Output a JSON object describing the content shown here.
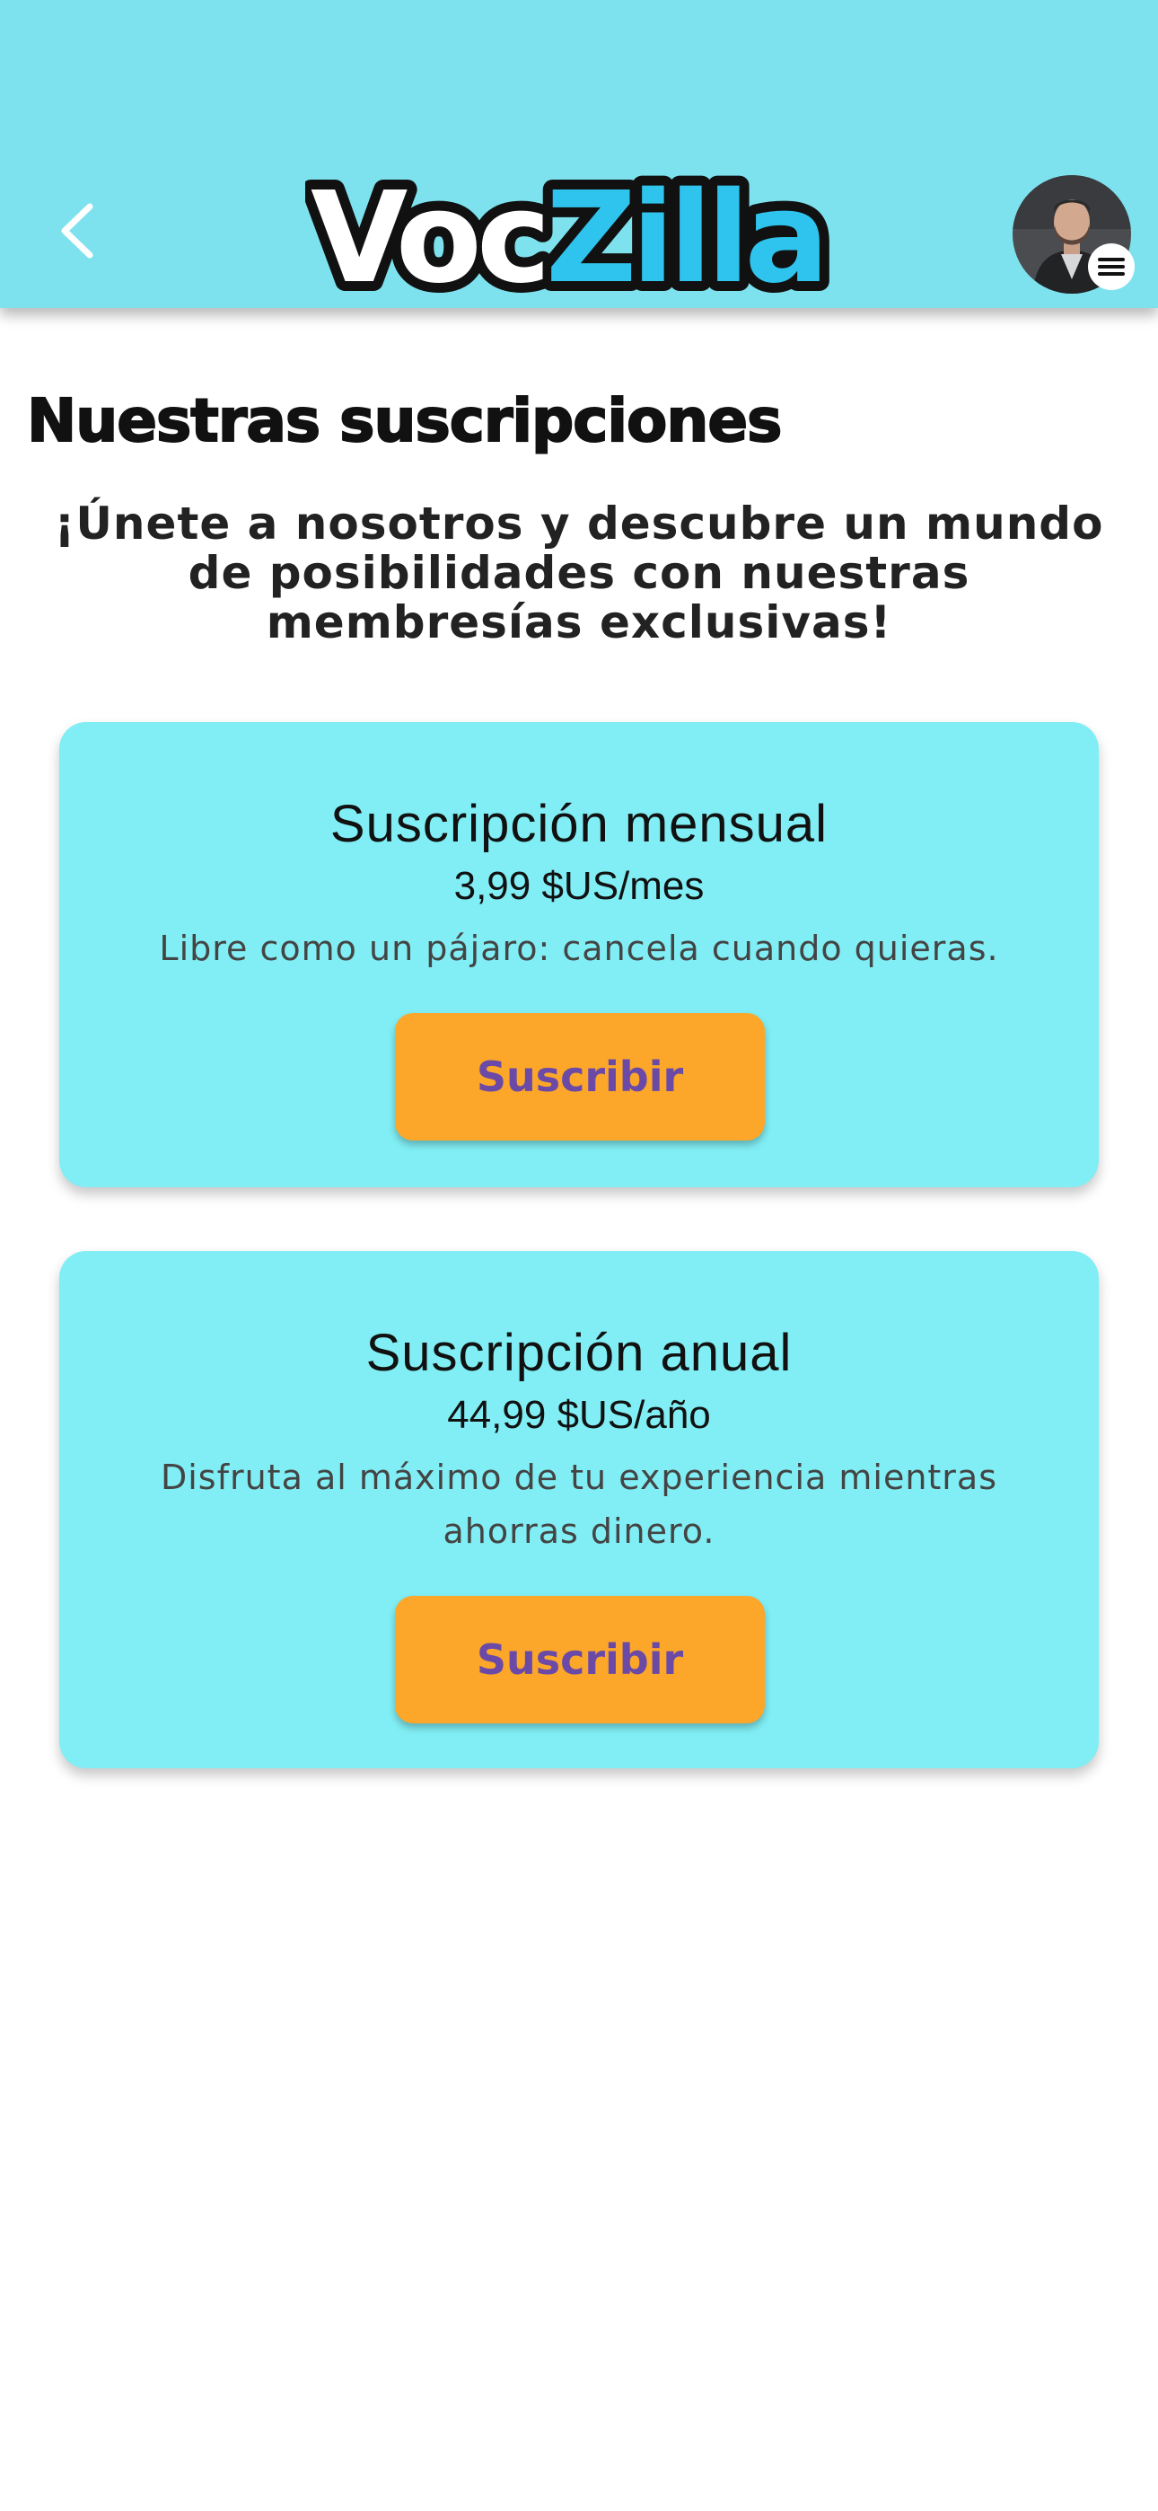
{
  "header": {
    "logo_part1": "Voc",
    "logo_part2": "Zilla",
    "back_icon": "chevron-left-icon",
    "avatar_menu_icon": "hamburger-menu-icon"
  },
  "main": {
    "title": "Nuestras suscripciones",
    "intro": "¡Únete a nosotros y descubre un mundo de posibilidades con nuestras membresías exclusivas!"
  },
  "plans": [
    {
      "title": "Suscripción mensual",
      "price": "3,99 $US/mes",
      "description": "Libre como un pájaro: cancela cuando quieras.",
      "button_label": "Suscribir"
    },
    {
      "title": "Suscripción anual",
      "price": "44,99 $US/año",
      "description": "Disfruta al máximo de tu experiencia mientras ahorras dinero.",
      "button_label": "Suscribir"
    }
  ],
  "colors": {
    "header_bg": "#7de2ee",
    "card_bg": "#80eef4",
    "button_bg": "#fca62a",
    "button_text": "#6a4aa6",
    "logo_accent": "#2ec4ee"
  }
}
